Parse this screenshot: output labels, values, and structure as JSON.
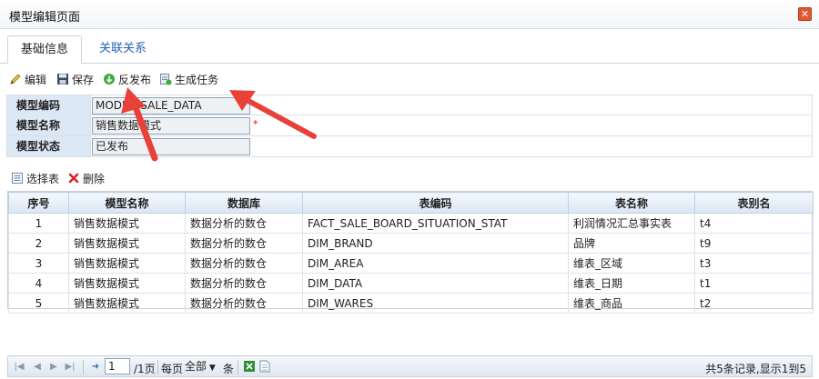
{
  "window": {
    "title": "模型编辑页面",
    "close_glyph": "✕"
  },
  "tabs": [
    {
      "label": "基础信息",
      "active": true
    },
    {
      "label": "关联关系",
      "active": false
    }
  ],
  "toolbar": {
    "edit_label": "编辑",
    "save_label": "保存",
    "unpublish_label": "反发布",
    "generate_task_label": "生成任务"
  },
  "form": {
    "fields": [
      {
        "label": "模型编码",
        "value": "MODEL_SALE_DATA",
        "required": false
      },
      {
        "label": "模型名称",
        "value": "销售数据模式",
        "required": true,
        "required_mark": "*"
      },
      {
        "label": "模型状态",
        "value": "已发布",
        "required": false
      }
    ]
  },
  "subtoolbar": {
    "select_table_label": "选择表",
    "delete_label": "删除"
  },
  "table": {
    "columns": [
      "序号",
      "模型名称",
      "数据库",
      "表编码",
      "表名称",
      "表别名"
    ],
    "rows": [
      [
        "1",
        "销售数据模式",
        "数据分析的数仓",
        "FACT_SALE_BOARD_SITUATION_STAT",
        "利润情况汇总事实表",
        "t4"
      ],
      [
        "2",
        "销售数据模式",
        "数据分析的数仓",
        "DIM_BRAND",
        "品牌",
        "t9"
      ],
      [
        "3",
        "销售数据模式",
        "数据分析的数仓",
        "DIM_AREA",
        "维表_区域",
        "t3"
      ],
      [
        "4",
        "销售数据模式",
        "数据分析的数仓",
        "DIM_DATA",
        "维表_日期",
        "t1"
      ],
      [
        "5",
        "销售数据模式",
        "数据分析的数仓",
        "DIM_WARES",
        "维表_商品",
        "t2"
      ]
    ]
  },
  "pager": {
    "page_input": "1",
    "page_total": "/1页",
    "per_page_label": "每页",
    "per_page_value": "全部",
    "per_page_suffix": "条",
    "summary": "共5条记录,显示1到5"
  },
  "colors": {
    "accent": "#1f65b5",
    "annotation_arrow": "#e8413a",
    "label_bg": "#dde8f5"
  },
  "icons": [
    "pencil-icon",
    "floppy-save-icon",
    "green-circle-arrow-icon",
    "generate-task-icon",
    "list-icon",
    "red-x-icon",
    "first-page-icon",
    "prev-page-icon",
    "next-page-icon",
    "last-page-icon",
    "go-arrow-icon",
    "excel-export-icon",
    "document-icon"
  ]
}
